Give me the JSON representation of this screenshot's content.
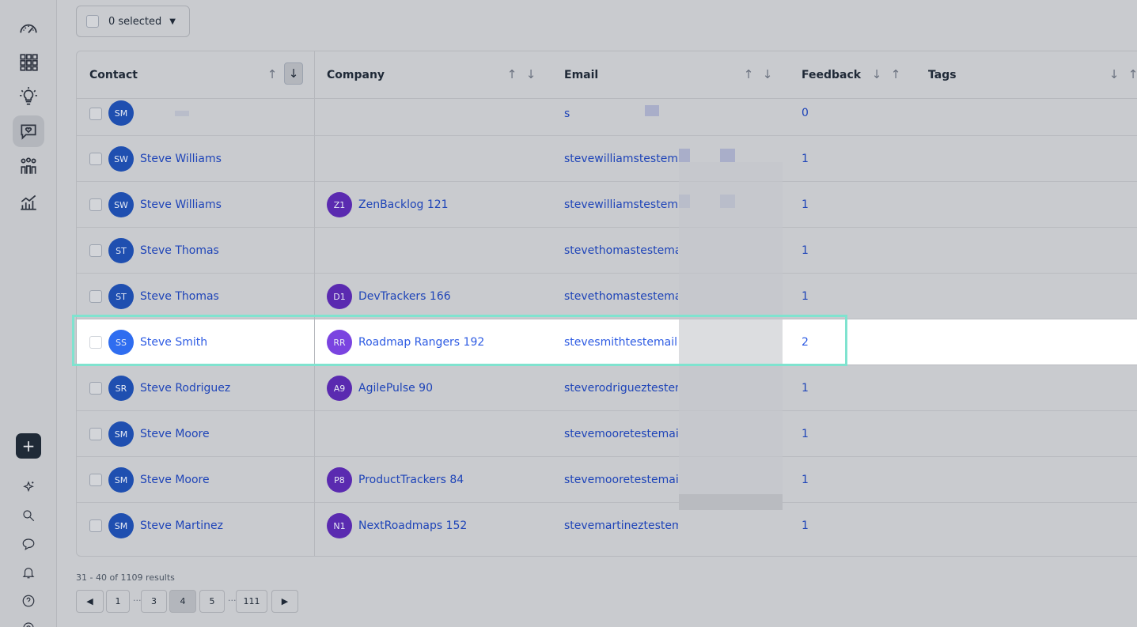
{
  "toolbar": {
    "selected_label": "0 selected"
  },
  "columns": {
    "contact": "Contact",
    "company": "Company",
    "email": "Email",
    "feedback": "Feedback",
    "tags": "Tags"
  },
  "rows": [
    {
      "initials": "SM",
      "name": "",
      "company_initials": "",
      "company": "",
      "email": "s",
      "feedback": "0"
    },
    {
      "initials": "SW",
      "name": "Steve Williams",
      "company_initials": "",
      "company": "",
      "email": "stevewilliamstestemail@",
      "feedback": "1"
    },
    {
      "initials": "SW",
      "name": "Steve Williams",
      "company_initials": "Z1",
      "company": "ZenBacklog 121",
      "email": "stevewilliamstestemail@",
      "feedback": "1"
    },
    {
      "initials": "ST",
      "name": "Steve Thomas",
      "company_initials": "",
      "company": "",
      "email": "stevethomastestemail@",
      "feedback": "1"
    },
    {
      "initials": "ST",
      "name": "Steve Thomas",
      "company_initials": "D1",
      "company": "DevTrackers 166",
      "email": "stevethomastestemail@",
      "feedback": "1"
    },
    {
      "initials": "SS",
      "name": "Steve Smith",
      "company_initials": "RR",
      "company": "Roadmap Rangers 192",
      "email": "stevesmithtestemail@p",
      "feedback": "2"
    },
    {
      "initials": "SR",
      "name": "Steve Rodriguez",
      "company_initials": "A9",
      "company": "AgilePulse 90",
      "email": "steverodrigueztestema",
      "feedback": "1"
    },
    {
      "initials": "SM",
      "name": "Steve Moore",
      "company_initials": "",
      "company": "",
      "email": "stevemooretestemail@",
      "feedback": "1"
    },
    {
      "initials": "SM",
      "name": "Steve Moore",
      "company_initials": "P8",
      "company": "ProductTrackers 84",
      "email": "stevemooretestemail@",
      "feedback": "1"
    },
    {
      "initials": "SM",
      "name": "Steve Martinez",
      "company_initials": "N1",
      "company": "NextRoadmaps 152",
      "email": "stevemartineztestemai",
      "feedback": "1"
    }
  ],
  "pagination": {
    "summary": "31 - 40 of 1109 results",
    "pages": [
      "1",
      "3",
      "4",
      "5",
      "111"
    ],
    "current": "4",
    "ellipsis": "..."
  },
  "colors": {
    "contact_avatar": "#1f4fb0",
    "company_avatar": "#5a2ab0",
    "link": "#1e44b8",
    "highlight_border": "#7fe3cf"
  }
}
